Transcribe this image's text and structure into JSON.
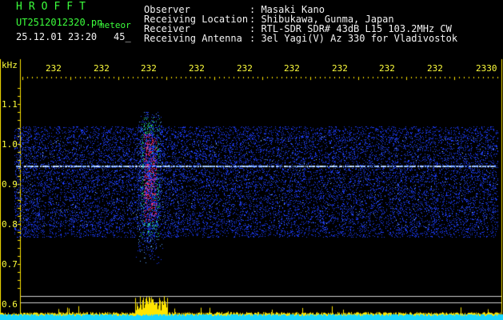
{
  "station": {
    "title": "HROFFT",
    "filename": "UT2512012320.pn",
    "file_tag": "meteor",
    "datetime": "25.12.01 23:20",
    "display_value": "45_"
  },
  "info": [
    {
      "label": "Observer",
      "value": ": Masaki Kano"
    },
    {
      "label": "Receiving Location",
      "value": ": Shibukawa, Gunma, Japan"
    },
    {
      "label": "Receiver",
      "value": ": RTL-SDR SDR# 43dB L15 103.2MHz CW"
    },
    {
      "label": "Receiving Antenna",
      "value": ": 3el Yagi(V) Az 330 for Vladivostok"
    }
  ],
  "axes": {
    "y_unit": "kHz",
    "time_ticks": [
      "232",
      "232",
      "232",
      "232",
      "232",
      "232",
      "232",
      "232",
      "232",
      "2330"
    ],
    "freq_ticks": [
      "1.1",
      "1.0",
      "0.9",
      "0.8",
      "0.7",
      "0.6"
    ]
  },
  "colors": {
    "background": "#000000",
    "noise": "#1c3cff",
    "carrier": "#7fb0ff",
    "echo_core": "#ff2a5a",
    "echo_mid": "#2ee07a",
    "bottom_strip": "#19d6ff",
    "amplitude": "#ffe600",
    "text_yellow": "#ffff3c",
    "text_green": "#3cff3c"
  }
}
